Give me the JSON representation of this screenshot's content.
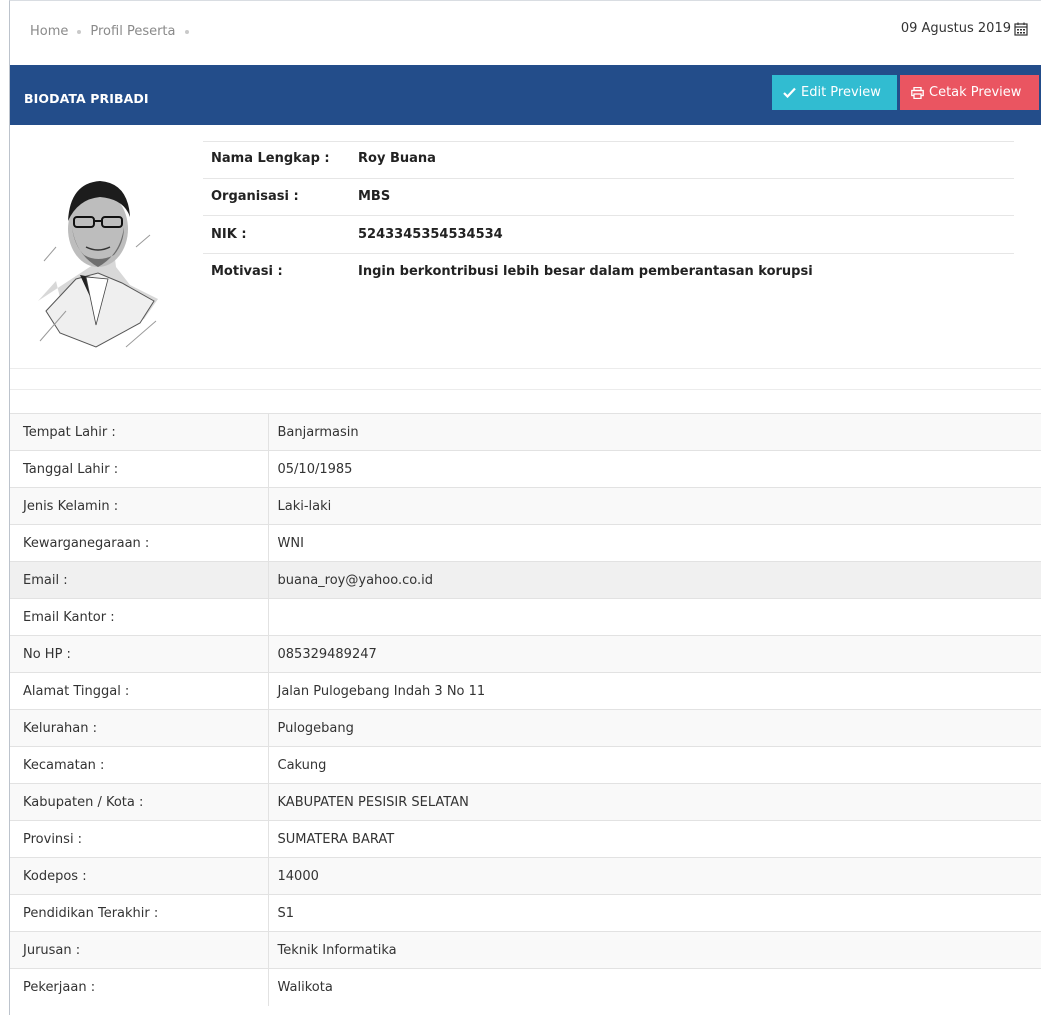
{
  "breadcrumb": [
    "Home",
    "Profil Peserta"
  ],
  "date": "09 Agustus 2019",
  "panel": {
    "title": "BIODATA PRIBADI",
    "edit_label": "Edit Preview",
    "print_label": "Cetak Preview",
    "edit_color": "#31bcd1",
    "print_color": "#ea5561",
    "header_color": "#234d8a"
  },
  "profile": {
    "photo": "avatar-portrait",
    "fields": [
      {
        "label": "Nama Lengkap :",
        "value": "Roy Buana"
      },
      {
        "label": "Organisasi :",
        "value": "MBS"
      },
      {
        "label": "NIK :",
        "value": "5243345354534534"
      },
      {
        "label": "Motivasi :",
        "value": "Ingin berkontribusi lebih besar dalam pemberantasan korupsi"
      }
    ]
  },
  "details": [
    {
      "label": "Tempat Lahir :",
      "value": "Banjarmasin"
    },
    {
      "label": "Tanggal Lahir :",
      "value": "05/10/1985"
    },
    {
      "label": "Jenis Kelamin :",
      "value": "Laki-laki"
    },
    {
      "label": "Kewarganegaraan :",
      "value": "WNI"
    },
    {
      "label": "Email :",
      "value": "buana_roy@yahoo.co.id"
    },
    {
      "label": "Email Kantor :",
      "value": ""
    },
    {
      "label": "No HP :",
      "value": "085329489247"
    },
    {
      "label": "Alamat Tinggal :",
      "value": "Jalan Pulogebang Indah 3 No 11"
    },
    {
      "label": "Kelurahan :",
      "value": "Pulogebang"
    },
    {
      "label": "Kecamatan :",
      "value": "Cakung"
    },
    {
      "label": "Kabupaten / Kota :",
      "value": "KABUPATEN PESISIR SELATAN"
    },
    {
      "label": "Provinsi :",
      "value": "SUMATERA BARAT"
    },
    {
      "label": "Kodepos :",
      "value": "14000"
    },
    {
      "label": "Pendidikan Terakhir :",
      "value": "S1"
    },
    {
      "label": "Jurusan :",
      "value": "Teknik Informatika"
    },
    {
      "label": "Pekerjaan :",
      "value": "Walikota"
    }
  ]
}
